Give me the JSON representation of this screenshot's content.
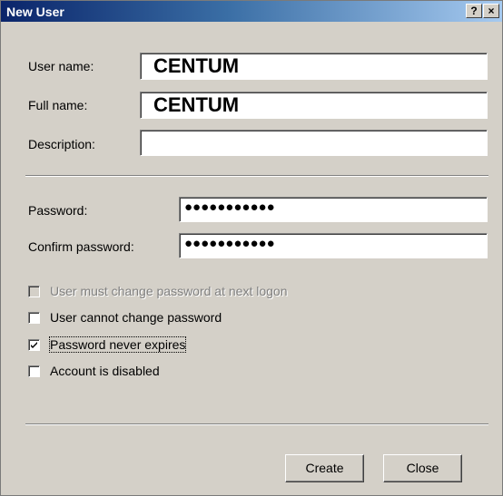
{
  "window": {
    "title": "New User",
    "help_button": "?",
    "close_button": "×"
  },
  "fields": {
    "username_label": "User name:",
    "username_value": "CENTUM",
    "fullname_label": "Full name:",
    "fullname_value": "CENTUM",
    "description_label": "Description:",
    "description_value": "",
    "password_label": "Password:",
    "password_value": "●●●●●●●●●●●",
    "confirm_label": "Confirm password:",
    "confirm_value": "●●●●●●●●●●●"
  },
  "options": [
    {
      "label": "User must change password at next logon",
      "checked": false,
      "disabled": true
    },
    {
      "label": "User cannot change password",
      "checked": false,
      "disabled": false
    },
    {
      "label": "Password never expires",
      "checked": true,
      "disabled": false
    },
    {
      "label": "Account is disabled",
      "checked": false,
      "disabled": false
    }
  ],
  "buttons": {
    "create_label": "Create",
    "close_label": "Close"
  },
  "colors": {
    "dialog_bg": "#d4d0c8",
    "title_start": "#0a246a",
    "title_end": "#a6caf0"
  }
}
